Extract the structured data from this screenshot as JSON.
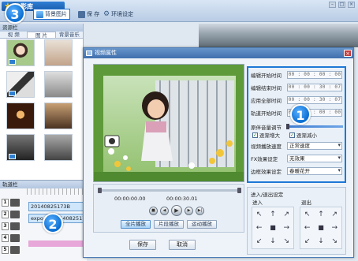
{
  "app": {
    "title_short": "编辑",
    "logo_text": "简影库",
    "toolbar": {
      "bg_image_label": "背景图片",
      "save_label": "保 存",
      "settings_label": "环境设定"
    }
  },
  "resources": {
    "header": "资源栏",
    "tabs": [
      "视 频",
      "图 片",
      "背景音乐"
    ],
    "active_tab": 1
  },
  "timeline": {
    "header": "轨道栏",
    "clips": [
      "20140825173B",
      "expo",
      "201408251738"
    ]
  },
  "dialog": {
    "title": "视频属性",
    "close_glyph": "×",
    "player": {
      "time_start": "00:00:00.00",
      "time_end": "00:00:30.01",
      "modes": [
        "全片播放",
        "片段播放",
        "运动播放"
      ],
      "active_mode": 0
    },
    "settings": {
      "fields": [
        {
          "label": "编辑开始时间",
          "value": "00 : 00 : 00 : 00"
        },
        {
          "label": "编辑结束时间",
          "value": "00 : 00 : 30 : 07"
        },
        {
          "label": "应用全部时间",
          "value": "00 : 00 : 30 : 07"
        },
        {
          "label": "轨道开始时间",
          "value": "00 : 00 : 00 : 00"
        }
      ],
      "volume_label": "原伴音量调节",
      "volume_level": 1.0,
      "fade_in": "逐渐增大",
      "fade_out": "逐渐减小",
      "fade_in_checked": true,
      "fade_out_checked": true,
      "selects": [
        {
          "label": "视频播放速度",
          "value": "正常速度"
        },
        {
          "label": "FX效果设定",
          "value": "无效果"
        },
        {
          "label": "边框效果设定",
          "value": "春暖花开"
        }
      ]
    },
    "transition": {
      "title": "进入/退出设定",
      "in_label": "进入",
      "out_label": "退出"
    },
    "buttons": {
      "save": "保存",
      "cancel": "取消"
    }
  },
  "callouts": [
    "3",
    "1",
    "2"
  ],
  "colors": {
    "accent": "#1d78d6",
    "title_bar": "#3f6fae"
  }
}
